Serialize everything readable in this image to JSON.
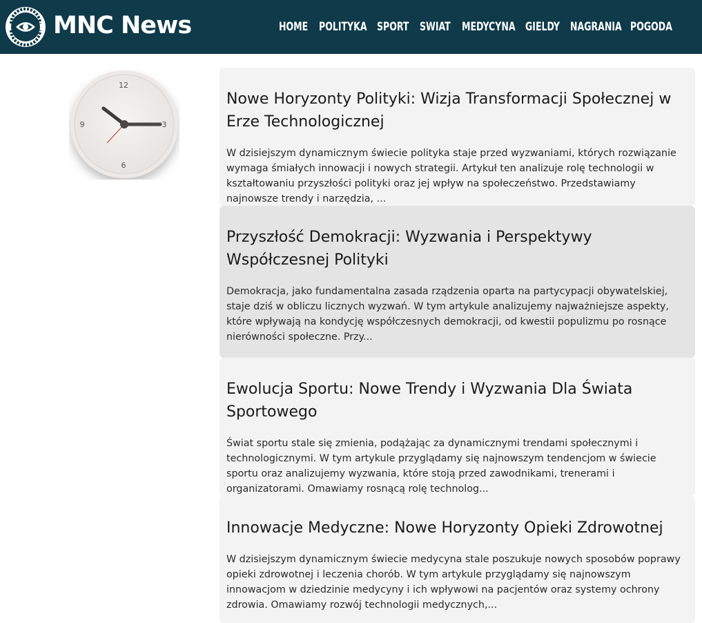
{
  "brand": {
    "name": "MNC News",
    "badge_text": "MNC News",
    "color": "#0e3a4a"
  },
  "nav": {
    "items": [
      "HOME",
      "POLITYKA",
      "SPORT",
      "SWIAT",
      "MEDYCYNA",
      "GIELDY",
      "NAGRANIA",
      "POGODA"
    ]
  },
  "clock": {
    "numerals": [
      "12",
      "3",
      "6",
      "9"
    ],
    "hour": 10,
    "minute": 15
  },
  "articles": [
    {
      "title": "Nowe Horyzonty Polityki: Wizja Transformacji Społecznej w Erze Technologicznej",
      "excerpt": "W dzisiejszym dynamicznym świecie polityka staje przed wyzwaniami, których rozwiązanie wymaga śmiałych innowacji i nowych strategii. Artykuł ten analizuje rolę technologii w kształtowaniu przyszłości polityki oraz jej wpływ na społeczeństwo. Przedstawiamy najnowsze trendy i narzędzia, ..."
    },
    {
      "title": "Przyszłość Demokracji: Wyzwania i Perspektywy Współczesnej Polityki",
      "excerpt": "Demokracja, jako fundamentalna zasada rządzenia oparta na partycypacji obywatelskiej, staje dziś w obliczu licznych wyzwań. W tym artykule analizujemy najważniejsze aspekty, które wpływają na kondycję współczesnych demokracji, od kwestii populizmu po rosnące nierówności społeczne. Przy..."
    },
    {
      "title": "Ewolucja Sportu: Nowe Trendy i Wyzwania Dla Świata Sportowego",
      "excerpt": "Świat sportu stale się zmienia, podążając za dynamicznymi trendami społecznymi i technologicznymi. W tym artykule przyglądamy się najnowszym tendencjom w świecie sportu oraz analizujemy wyzwania, które stoją przed zawodnikami, trenerami i organizatorami. Omawiamy rosnącą rolę technolog..."
    },
    {
      "title": "Innowacje Medyczne: Nowe Horyzonty Opieki Zdrowotnej",
      "excerpt": "W dzisiejszym dynamicznym świecie medycyna stale poszukuje nowych sposobów poprawy opieki zdrowotnej i leczenia chorób. W tym artykule przyglądamy się najnowszym innowacjom w dziedzinie medycyny i ich wpływowi na pacjentów oraz systemy ochrony zdrowia. Omawiamy rozwój technologii medycznych,..."
    }
  ]
}
